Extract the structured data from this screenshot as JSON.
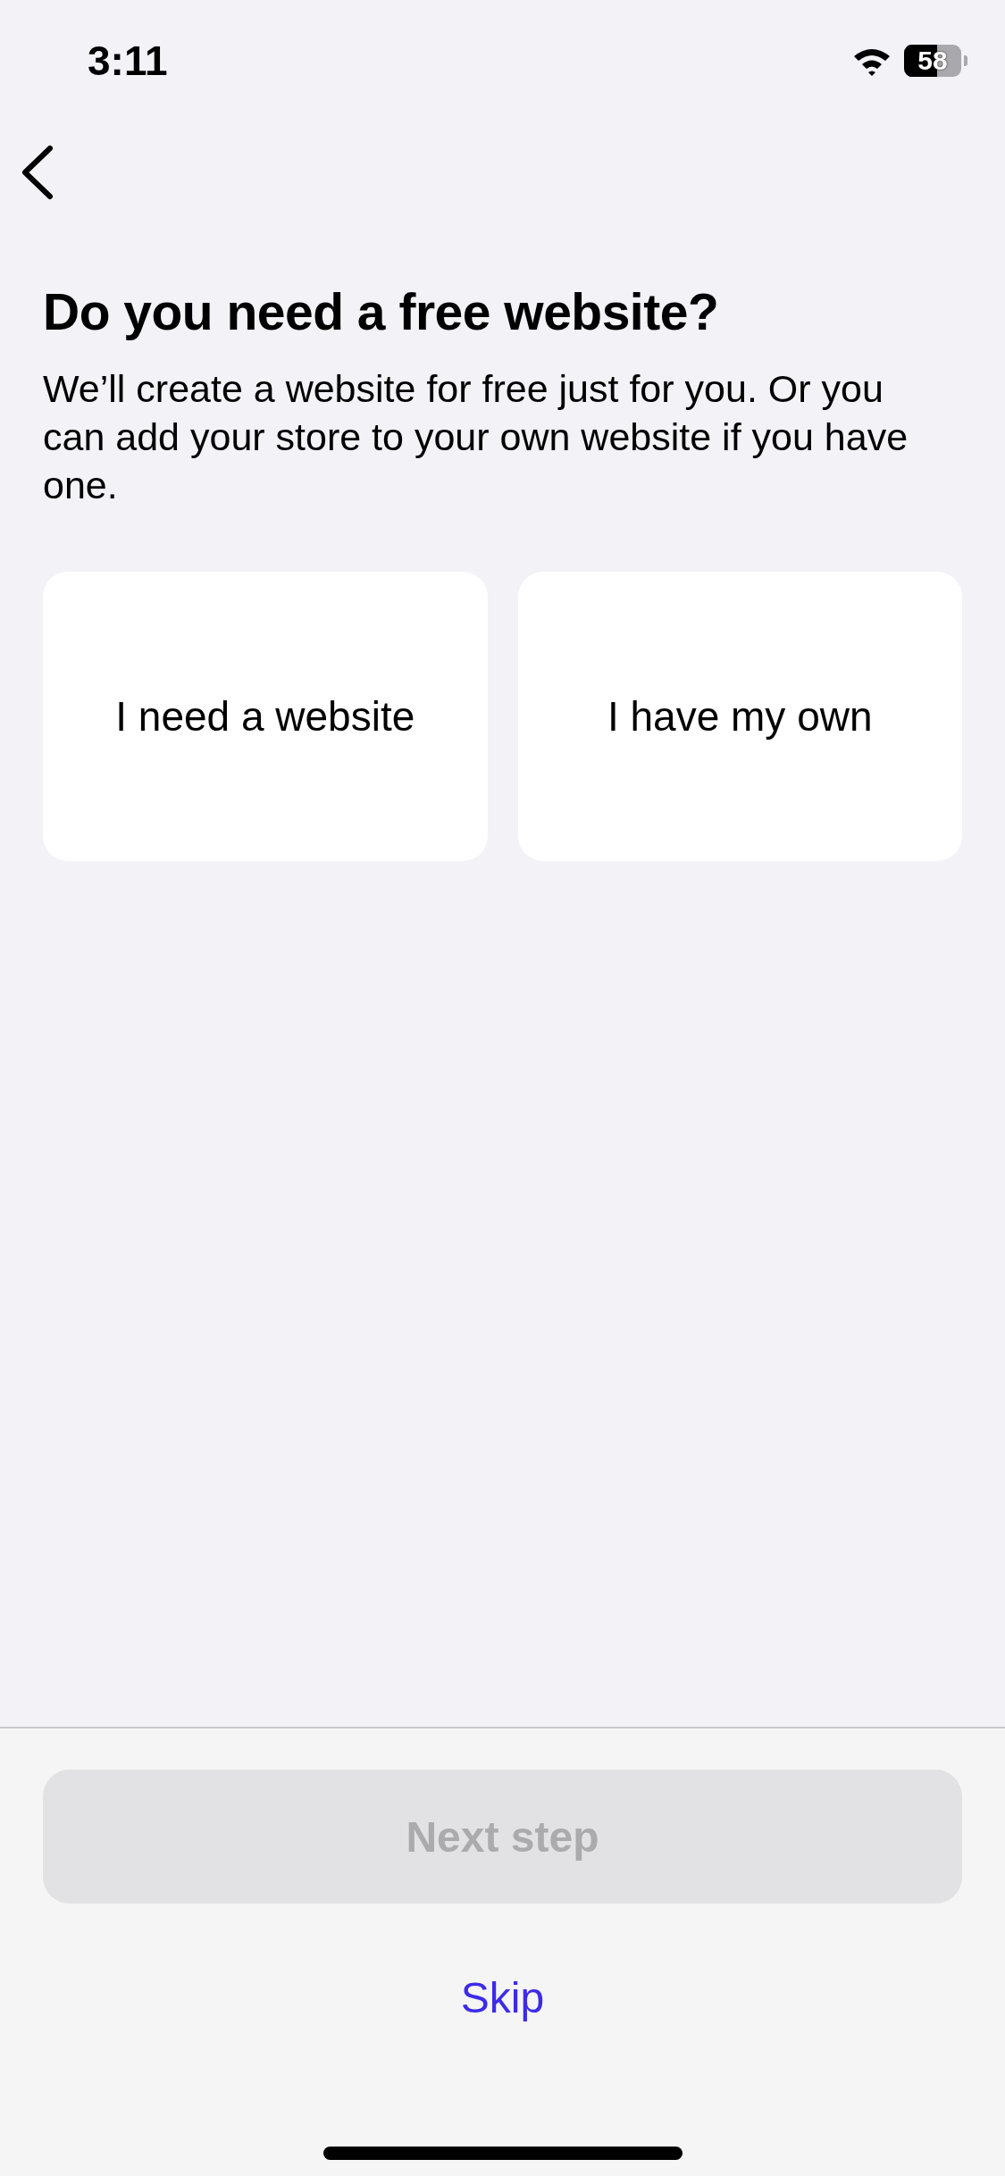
{
  "status_bar": {
    "time": "3:11",
    "battery": "58"
  },
  "title": "Do you need a free website?",
  "description": "We’ll create a website for free just for you. Or you can add your store to your own website if you have one.",
  "options": [
    {
      "label": "I need a website",
      "selected": false
    },
    {
      "label": "I have my own",
      "selected": false
    }
  ],
  "next_button": {
    "label": "Next step",
    "disabled": true
  },
  "skip_link": "Skip"
}
